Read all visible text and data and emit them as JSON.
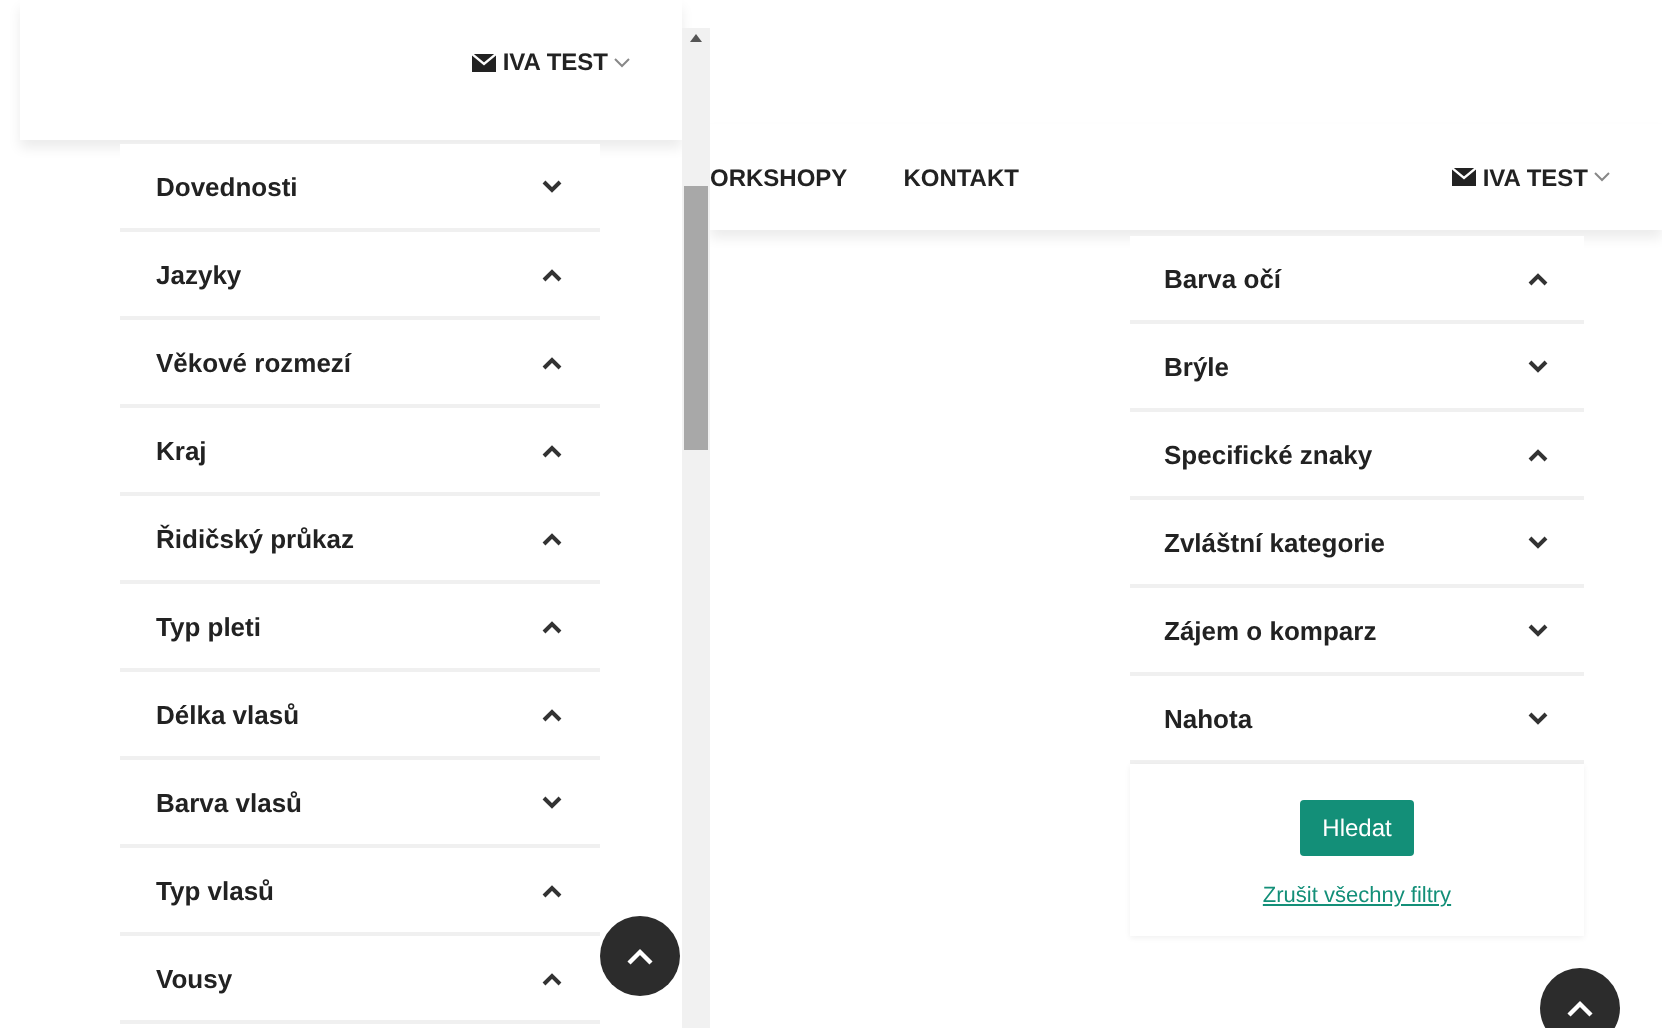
{
  "left_panel": {
    "user_menu": {
      "label": "IVA TEST"
    },
    "filters": [
      {
        "label": "Dovednosti",
        "expanded": false
      },
      {
        "label": "Jazyky",
        "expanded": true
      },
      {
        "label": "Věkové rozmezí",
        "expanded": true
      },
      {
        "label": "Kraj",
        "expanded": true
      },
      {
        "label": "Řidičský průkaz",
        "expanded": true
      },
      {
        "label": "Typ pleti",
        "expanded": true
      },
      {
        "label": "Délka vlasů",
        "expanded": true
      },
      {
        "label": "Barva vlasů",
        "expanded": false
      },
      {
        "label": "Typ vlasů",
        "expanded": true
      },
      {
        "label": "Vousy",
        "expanded": true
      }
    ]
  },
  "right_panel": {
    "nav": [
      {
        "label": "ORKSHOPY"
      },
      {
        "label": "KONTAKT"
      }
    ],
    "user_menu": {
      "label": "IVA TEST"
    },
    "filters": [
      {
        "label": "Barva očí",
        "expanded": true
      },
      {
        "label": "Brýle",
        "expanded": false
      },
      {
        "label": "Specifické znaky",
        "expanded": true
      },
      {
        "label": "Zvláštní kategorie",
        "expanded": false
      },
      {
        "label": "Zájem o komparz",
        "expanded": false
      },
      {
        "label": "Nahota",
        "expanded": false
      }
    ],
    "search_button": "Hledat",
    "clear_link": "Zrušit všechny filtry"
  }
}
